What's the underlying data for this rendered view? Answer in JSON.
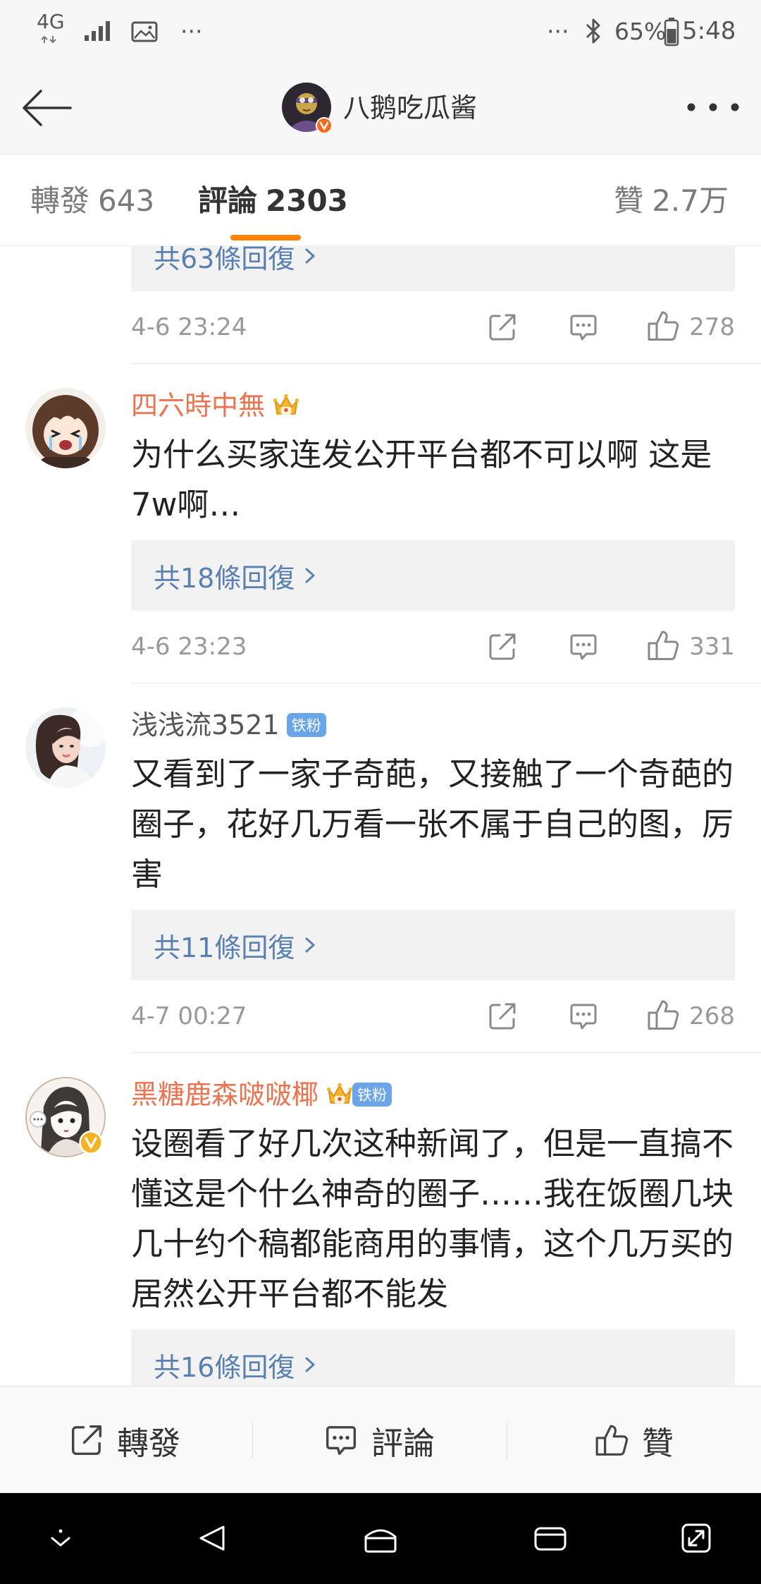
{
  "status_bar": {
    "network": "4G",
    "left_overflow": "···",
    "right_overflow": "···",
    "battery_text": "65%",
    "time": "5:48",
    "icons": [
      "signal-icon",
      "gallery-icon",
      "bluetooth-icon",
      "battery-icon"
    ]
  },
  "header": {
    "title": "八鹅吃瓜酱",
    "back_icon": "back-arrow-icon",
    "more_icon": "more-dots-icon"
  },
  "tabs": [
    {
      "label": "轉發",
      "count": "643",
      "active": false
    },
    {
      "label": "評論",
      "count": "2303",
      "active": true
    },
    {
      "label": "贊",
      "count": "2.7万",
      "active": false
    }
  ],
  "colors": {
    "accent": "#ff8200",
    "vip_name": "#eb7350",
    "link": "#5a80b2",
    "meta": "#999999",
    "fan_badge": "#6aa5ea"
  },
  "comments": [
    {
      "replies": "共63條回復",
      "time": "4-6 23:24",
      "likes": "278"
    },
    {
      "name": "四六時中無",
      "vip": true,
      "badges": [
        "vip-crown-icon"
      ],
      "text_lines": [
        "为什么买家连发公开平台都不可以啊 这是",
        "7w啊…"
      ],
      "replies": "共18條回復",
      "time": "4-6 23:23",
      "likes": "331"
    },
    {
      "name": "浅浅流3521",
      "vip": false,
      "fan_badge": "铁粉",
      "text_lines": [
        "又看到了一家子奇葩，又接触了一个奇葩的",
        "圈子，花好几万看一张不属于自己的图，厉",
        "害"
      ],
      "replies": "共11條回復",
      "time": "4-7 00:27",
      "likes": "268"
    },
    {
      "name": "黑糖鹿森啵啵椰",
      "vip": true,
      "verified": true,
      "badges": [
        "vip-crown-icon"
      ],
      "fan_badge": "铁粉",
      "text_lines": [
        "设圈看了好几次这种新闻了，但是一直搞不",
        "懂这是个什么神奇的圈子……我在饭圈几块",
        "几十约个稿都能商用的事情，这个几万买的",
        "居然公开平台都不能发"
      ],
      "replies": "共16條回復"
    }
  ],
  "bottom_bar": [
    {
      "label": "轉發",
      "icon": "repost-icon"
    },
    {
      "label": "評論",
      "icon": "comment-icon"
    },
    {
      "label": "贊",
      "icon": "like-icon"
    }
  ],
  "nav_bar": {
    "icons": [
      "hide-nav-icon",
      "back-icon",
      "home-icon",
      "recents-icon",
      "multi-window-icon"
    ]
  }
}
